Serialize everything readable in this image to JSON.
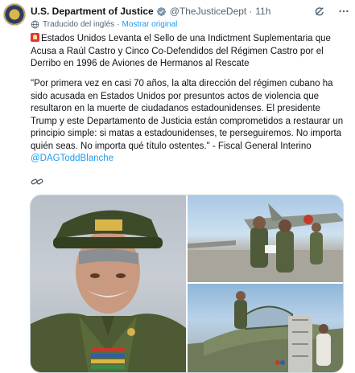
{
  "author": {
    "name": "U.S. Department of Justice",
    "handle": "@TheJusticeDept",
    "separator": "·",
    "time": "11h"
  },
  "translation": {
    "label": "Traducido del inglés",
    "separator": "·",
    "show_original": "Mostrar original"
  },
  "tweet": {
    "paragraph1": "Estados Unidos Levanta el Sello de una Indictment Suplementaria que Acusa a Raúl Castro y Cinco Co-Defendidos del Régimen Castro por el Derribo en 1996 de Aviones de Hermanos al Rescate",
    "paragraph2_text": "\"Por primera vez en casi 70 años, la alta dirección del régimen cubano ha sido acusada en Estados Unidos por presuntos actos de violencia que resultaron en la muerte de ciudadanos estadounidenses. El presidente Trump y este Departamento de Justicia están comprometidos a restaurar un principio simple: si matas a estadounidenses, te perseguiremos. No importa quién seas. No importa qué título ostentes.\" - Fiscal General Interino ",
    "mention": "@DAGToddBlanche"
  },
  "icons": {
    "verified": "verified-badge-icon",
    "grok": "grok-icon",
    "more": "more-options-icon",
    "globe": "globe-icon",
    "link": "link-icon",
    "alarm": "police-light-emoji"
  },
  "colors": {
    "accent": "#1d9bf0",
    "secondary_text": "#536471",
    "text": "#0f1419",
    "border": "#cfd9de"
  }
}
